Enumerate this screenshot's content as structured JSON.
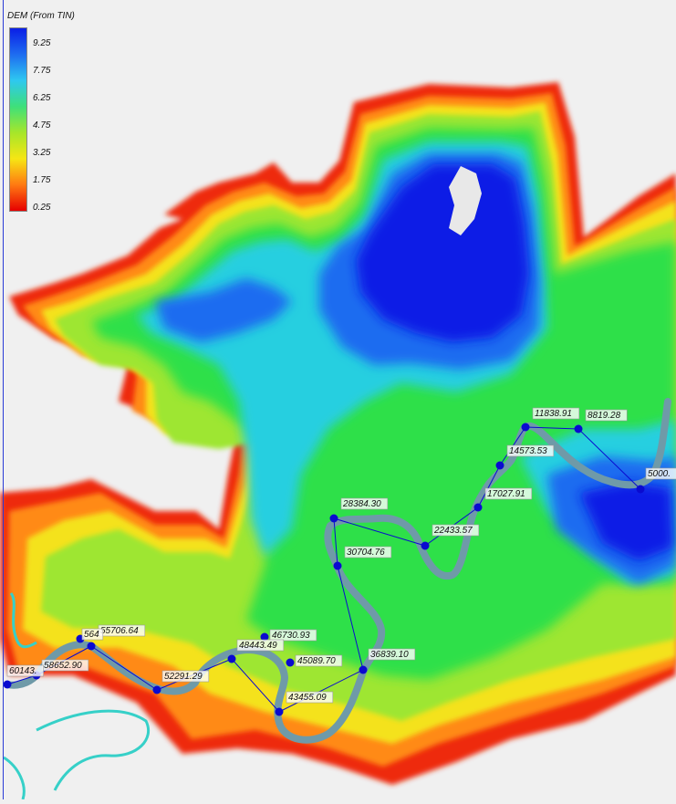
{
  "legend": {
    "title": "DEM (From TIN)",
    "ticks": [
      "9.25",
      "7.75",
      "6.25",
      "4.75",
      "3.25",
      "1.75",
      "0.25"
    ],
    "colors": [
      "#0a1ee6",
      "#1e6cf0",
      "#2ec8f0",
      "#3ee07a",
      "#a6e62a",
      "#f6e614",
      "#ff7a12",
      "#e60000"
    ]
  },
  "river": {
    "color": "#6f9aa8"
  },
  "cross_sections": {
    "line_color": "#0a0ad0",
    "stations": [
      {
        "id": "s5000",
        "label": "5000.",
        "visible": true
      },
      {
        "id": "s8819",
        "label": "8819.28",
        "visible": true
      },
      {
        "id": "s11838",
        "label": "11838.91",
        "visible": true
      },
      {
        "id": "s14573",
        "label": "14573.53",
        "visible": true
      },
      {
        "id": "s17027",
        "label": "17027.91",
        "visible": true
      },
      {
        "id": "s22433",
        "label": "22433.57",
        "visible": true
      },
      {
        "id": "s28384",
        "label": "28384.30",
        "visible": true
      },
      {
        "id": "s30704",
        "label": "30704.76",
        "visible": true
      },
      {
        "id": "s36839",
        "label": "36839.10",
        "visible": true
      },
      {
        "id": "s43455",
        "label": "43455.09",
        "visible": true
      },
      {
        "id": "s45089",
        "label": "45089.70",
        "visible": true
      },
      {
        "id": "s46730",
        "label": "46730.93",
        "visible": true
      },
      {
        "id": "s48443",
        "label": "48443.49",
        "visible": true
      },
      {
        "id": "s52291",
        "label": "52291.29",
        "visible": true
      },
      {
        "id": "s55706",
        "label": "55706.64",
        "visible": true
      },
      {
        "id": "s564",
        "label": "564",
        "visible": true
      },
      {
        "id": "s58652",
        "label": "58652.90",
        "visible": true
      },
      {
        "id": "s60143",
        "label": "60143.",
        "visible": true
      }
    ]
  }
}
